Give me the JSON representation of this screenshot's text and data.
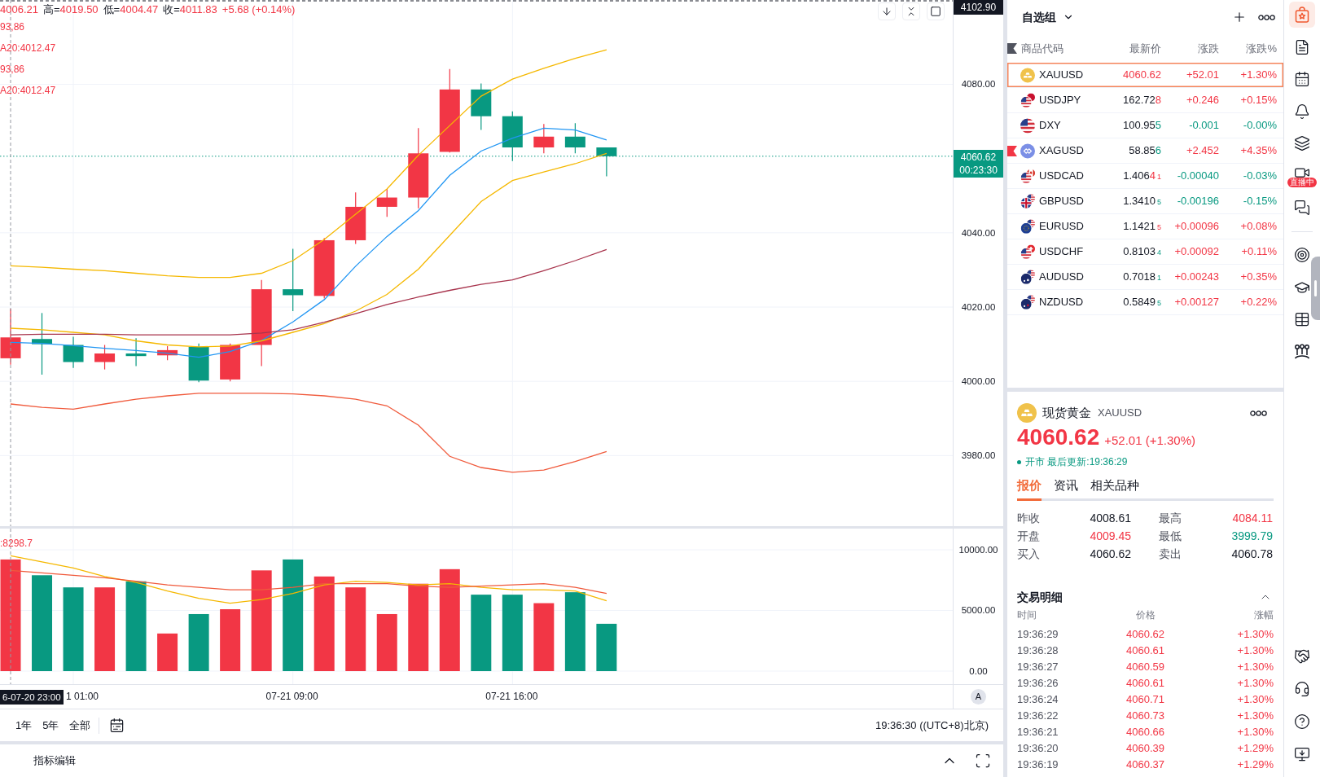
{
  "chart": {
    "legend": {
      "open": "4006.21",
      "items": [
        {
          "label": "高=",
          "value": "4019.50"
        },
        {
          "label": "低=",
          "value": "4004.47"
        },
        {
          "label": "收=",
          "value": "4011.83"
        }
      ],
      "change": "+5.68 (+0.14%)"
    },
    "indicator_values": [
      "93,86",
      "A20:4012.47",
      "93,86",
      "A20:4012.47"
    ],
    "volume_legend": ":8298.7",
    "countdown": "00:23:30",
    "crosshair_time": "6-07-20 23:00",
    "auto_scale_label": "A",
    "chart_data": [
      {
        "type": "candlestick",
        "grid": true,
        "ohlc": [
          [
            4006.21,
            4019.5,
            4004.47,
            4011.83
          ],
          [
            4011.4,
            4018.4,
            4001.8,
            4010.0
          ],
          [
            4009.8,
            4012.0,
            4003.6,
            4005.2
          ],
          [
            4005.2,
            4009.8,
            4003.2,
            4007.5
          ],
          [
            4007.5,
            4011.6,
            4004.1,
            4006.8
          ],
          [
            4007.0,
            4009.5,
            4005.7,
            4008.4
          ],
          [
            4009.3,
            4010.2,
            3999.79,
            4000.2
          ],
          [
            4000.5,
            4010.2,
            4000.0,
            4009.8
          ],
          [
            4009.8,
            4027.3,
            4004.1,
            4024.8
          ],
          [
            4024.8,
            4035.7,
            4018.9,
            4023.2
          ],
          [
            4023.0,
            4038.6,
            4022.3,
            4038.0
          ],
          [
            4038.0,
            4050.9,
            4037.0,
            4047.0
          ],
          [
            4047.0,
            4051.8,
            4044.3,
            4049.5
          ],
          [
            4049.5,
            4068.2,
            4046.6,
            4061.4
          ],
          [
            4061.8,
            4084.11,
            4061.6,
            4078.6
          ],
          [
            4078.6,
            4080.2,
            4067.7,
            4071.4
          ],
          [
            4071.4,
            4072.7,
            4059.3,
            4063.0
          ],
          [
            4063.0,
            4069.3,
            4061.4,
            4065.9
          ],
          [
            4065.9,
            4069.5,
            4061.4,
            4063.0
          ],
          [
            4063.0,
            4063.0,
            4055.2,
            4060.62
          ]
        ],
        "series": [
          {
            "type": "line",
            "color": "#2196f3",
            "values": [
              4010.5,
              4010.2,
              4009.6,
              4008.9,
              4008.3,
              4007.6,
              4006.5,
              4008.0,
              4011.0,
              4016.0,
              4022.0,
              4031.0,
              4039.0,
              4046.0,
              4055.5,
              4062.0,
              4065.5,
              4068.2,
              4067.7,
              4065.0
            ]
          },
          {
            "type": "line",
            "color": "#f5b800",
            "values": [
              4014.3,
              4013.9,
              4013.2,
              4012.5,
              4010.9,
              4009.8,
              4009.3,
              4009.5,
              4010.9,
              4013.2,
              4015.5,
              4018.9,
              4023.4,
              4030.2,
              4039.3,
              4048.4,
              4054.1,
              4056.4,
              4058.6,
              4061.4
            ]
          },
          {
            "type": "line",
            "color": "#f5b800",
            "values": [
              4031.1,
              4030.7,
              4030.2,
              4029.8,
              4029.1,
              4028.4,
              4028.0,
              4028.0,
              4029.1,
              4032.5,
              4038.2,
              4045.0,
              4051.8,
              4060.9,
              4068.9,
              4076.8,
              4081.4,
              4084.3,
              4087.0,
              4089.3
            ]
          },
          {
            "type": "line",
            "color": "#a8344d",
            "values": [
              4012.5,
              4012.7,
              4012.7,
              4012.7,
              4012.5,
              4012.5,
              4012.5,
              4012.5,
              4013.0,
              4013.9,
              4015.9,
              4018.2,
              4020.7,
              4022.7,
              4024.5,
              4026.1,
              4027.3,
              4029.8,
              4032.5,
              4035.5
            ]
          },
          {
            "type": "line",
            "color": "#f05a3c",
            "values": [
              3993.9,
              3993.0,
              3992.5,
              3993.9,
              3995.2,
              3996.1,
              3996.8,
              3996.8,
              3996.8,
              3996.6,
              3996.1,
              3995.2,
              3993.4,
              3988.2,
              3979.8,
              3976.8,
              3975.5,
              3976.1,
              3978.4,
              3981.1
            ]
          }
        ],
        "ylim": [
          3961,
          4102.7
        ],
        "yticks": [
          {
            "value": 3980,
            "label": "3980.00"
          },
          {
            "value": 4000,
            "label": "4000.00"
          },
          {
            "value": 4020,
            "label": "4020.00"
          },
          {
            "value": 4040,
            "label": "4040.00"
          },
          {
            "value": 4080,
            "label": "4080.00"
          }
        ],
        "ref_lines": [
          {
            "axis": "y",
            "value": 4102.9,
            "label": "4102.90",
            "color": "#131722",
            "line_style": "dashed"
          },
          {
            "axis": "y",
            "value": 4060.62,
            "label": "4060.62",
            "color": "#089981",
            "line_style": "dotted"
          }
        ]
      },
      {
        "type": "bar",
        "grid": true,
        "categories": [
          null,
          null,
          "1 01:00",
          null,
          null,
          null,
          null,
          null,
          null,
          "07-21 09:00",
          null,
          null,
          null,
          null,
          null,
          null,
          "07-21 16:00",
          null,
          null,
          null
        ],
        "values": [
          9200,
          7900,
          6900,
          6900,
          7400,
          3100,
          4700,
          5100,
          8300,
          9200,
          7800,
          6900,
          4700,
          7200,
          8400,
          6300,
          6300,
          5600,
          6500,
          3900
        ],
        "colors": [
          "#f23645",
          "#089981",
          "#089981",
          "#f23645",
          "#089981",
          "#f23645",
          "#089981",
          "#f23645",
          "#f23645",
          "#089981",
          "#f23645",
          "#f23645",
          "#f23645",
          "#f23645",
          "#f23645",
          "#089981",
          "#089981",
          "#f23645",
          "#089981",
          "#089981"
        ],
        "series": [
          {
            "type": "line",
            "color": "#f5b800",
            "values": [
              9500,
              9000,
              8500,
              7800,
              7300,
              6600,
              6000,
              5600,
              5900,
              6400,
              7100,
              7400,
              7300,
              7100,
              7200,
              6900,
              6700,
              6700,
              6600,
              5800
            ]
          },
          {
            "type": "line",
            "color": "#f05a3c",
            "values": [
              8300,
              8100,
              7900,
              7700,
              7400,
              7100,
              6900,
              6700,
              6700,
              6900,
              7200,
              7200,
              7200,
              7000,
              6900,
              7000,
              7100,
              7200,
              6900,
              6400
            ]
          }
        ],
        "ylim": [
          -1074,
          11745
        ],
        "yticks": [
          {
            "value": 0,
            "label": "0.00"
          },
          {
            "value": 5000,
            "label": "5000.00"
          },
          {
            "value": 10000,
            "label": "10000.00"
          }
        ]
      }
    ]
  },
  "period_bar": {
    "periods": [
      "1年",
      "5年",
      "全部"
    ],
    "clock": "19:36:30 ((UTC+8)北京)"
  },
  "bottom_bar": {
    "tabs": [
      "指标编辑"
    ]
  },
  "watchlist": {
    "title": "自选组",
    "columns": [
      "商品代码",
      "最新价",
      "涨跌",
      "涨跌%"
    ],
    "rows": [
      {
        "symbol": "XAUUSD",
        "price": {
          "tick": "4060.62"
        },
        "tick_rising": true,
        "change": "+52.01",
        "change_pct": "+1.30%",
        "rising": true,
        "selected": true,
        "flagged": false
      },
      {
        "symbol": "USDJPY",
        "price": {
          "base": "162.72",
          "tick": "8"
        },
        "tick_rising": true,
        "change": "+0.246",
        "change_pct": "+0.15%",
        "rising": true,
        "selected": false,
        "flagged": false
      },
      {
        "symbol": "DXY",
        "price": {
          "base": "100.95",
          "tick": "5"
        },
        "tick_rising": false,
        "change": "-0.001",
        "change_pct": "-0.00%",
        "rising": false,
        "selected": false,
        "flagged": false
      },
      {
        "symbol": "XAGUSD",
        "price": {
          "base": "58.85",
          "tick": "6"
        },
        "tick_rising": false,
        "change": "+2.452",
        "change_pct": "+4.35%",
        "rising": true,
        "selected": false,
        "flagged": true
      },
      {
        "symbol": "USDCAD",
        "price": {
          "base": "1.406",
          "tick": "4",
          "pip": "1"
        },
        "tick_rising": true,
        "change": "-0.00040",
        "change_pct": "-0.03%",
        "rising": false,
        "selected": false,
        "flagged": false
      },
      {
        "symbol": "GBPUSD",
        "price": {
          "base": "1.3410",
          "pip": "5"
        },
        "tick_rising": false,
        "change": "-0.00196",
        "change_pct": "-0.15%",
        "rising": false,
        "selected": false,
        "flagged": false
      },
      {
        "symbol": "EURUSD",
        "price": {
          "base": "1.1421",
          "pip": "5"
        },
        "tick_rising": true,
        "change": "+0.00096",
        "change_pct": "+0.08%",
        "rising": true,
        "selected": false,
        "flagged": false
      },
      {
        "symbol": "USDCHF",
        "price": {
          "base": "0.8103",
          "pip": "4"
        },
        "tick_rising": false,
        "change": "+0.00092",
        "change_pct": "+0.11%",
        "rising": true,
        "selected": false,
        "flagged": false
      },
      {
        "symbol": "AUDUSD",
        "price": {
          "base": "0.7018",
          "pip": "1"
        },
        "tick_rising": false,
        "change": "+0.00243",
        "change_pct": "+0.35%",
        "rising": true,
        "selected": false,
        "flagged": false
      },
      {
        "symbol": "NZDUSD",
        "price": {
          "base": "0.5849",
          "pip": "5"
        },
        "tick_rising": false,
        "change": "+0.00127",
        "change_pct": "+0.22%",
        "rising": true,
        "selected": false,
        "flagged": false
      }
    ]
  },
  "detail": {
    "name": "现货黄金",
    "symbol": "XAUUSD",
    "price": "4060.62",
    "change": "+52.01 (+1.30%)",
    "rising": true,
    "market_open": true,
    "status": "开市 最后更新:19:36:29",
    "tabs": [
      {
        "label": "报价",
        "selected": true
      },
      {
        "label": "资讯",
        "selected": false
      },
      {
        "label": "相关品种",
        "selected": false
      }
    ],
    "stats": [
      {
        "label": "昨收",
        "value": "4008.61"
      },
      {
        "label": "最高",
        "value": "4084.11",
        "rising": true
      },
      {
        "label": "开盘",
        "value": "4009.45",
        "rising": true
      },
      {
        "label": "最低",
        "value": "3999.79",
        "rising": false
      },
      {
        "label": "买入",
        "value": "4060.62"
      },
      {
        "label": "卖出",
        "value": "4060.78"
      }
    ],
    "trades": {
      "title": "交易明细",
      "expanded": true,
      "columns": [
        "时间",
        "价格",
        "涨幅"
      ],
      "rows": [
        {
          "time": "19:36:29",
          "price": "4060.62",
          "change": "+1.30%",
          "rising": true
        },
        {
          "time": "19:36:28",
          "price": "4060.61",
          "change": "+1.30%",
          "rising": true
        },
        {
          "time": "19:36:27",
          "price": "4060.59",
          "change": "+1.30%",
          "rising": true
        },
        {
          "time": "19:36:26",
          "price": "4060.61",
          "change": "+1.30%",
          "rising": true
        },
        {
          "time": "19:36:24",
          "price": "4060.71",
          "change": "+1.30%",
          "rising": true
        },
        {
          "time": "19:36:22",
          "price": "4060.73",
          "change": "+1.30%",
          "rising": true
        },
        {
          "time": "19:36:21",
          "price": "4060.66",
          "change": "+1.30%",
          "rising": true
        },
        {
          "time": "19:36:20",
          "price": "4060.39",
          "change": "+1.29%",
          "rising": true
        },
        {
          "time": "19:36:19",
          "price": "4060.37",
          "change": "+1.29%",
          "rising": true
        }
      ]
    }
  },
  "side_toolbar": {
    "groups": [
      [
        {
          "selected": true
        },
        {
          "selected": false
        },
        {
          "selected": false
        },
        {
          "selected": false
        },
        {
          "selected": false
        },
        {
          "selected": false,
          "badge": "直播中"
        },
        {
          "selected": false
        }
      ],
      [
        {
          "selected": false
        },
        {
          "selected": false
        },
        {
          "selected": false
        },
        {
          "selected": false
        }
      ],
      [
        {
          "selected": false
        },
        {
          "selected": false
        },
        {
          "selected": false
        },
        {
          "selected": false
        }
      ]
    ]
  }
}
